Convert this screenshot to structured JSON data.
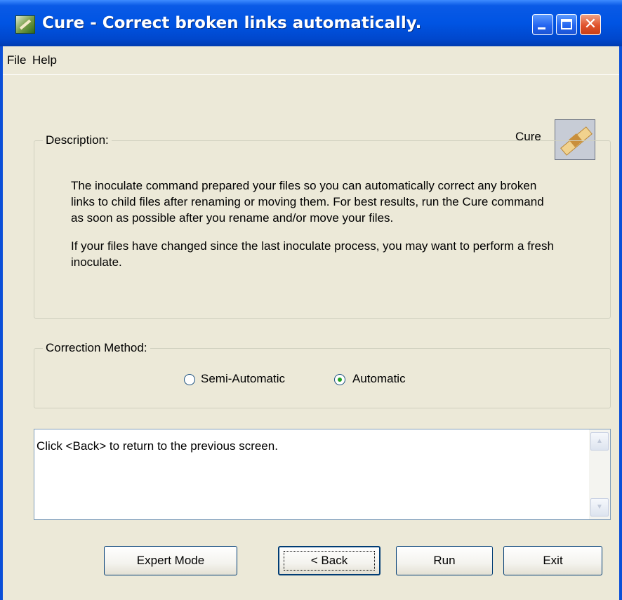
{
  "window": {
    "title": "Cure - Correct broken links automatically."
  },
  "menu": {
    "file": "File",
    "help": "Help"
  },
  "header": {
    "label": "Cure"
  },
  "description": {
    "legend": "Description:",
    "paragraph1": "The inoculate command prepared your files so you can automatically correct any broken links to child files after renaming or moving them. For best results, run the Cure command as soon as possible after you rename and/or move your files.",
    "paragraph2": "If your files have changed since the last inoculate process, you may want to perform a fresh inoculate."
  },
  "correction": {
    "legend": "Correction Method:",
    "options": [
      {
        "label": "Semi-Automatic",
        "selected": false
      },
      {
        "label": "Automatic",
        "selected": true
      }
    ]
  },
  "log": {
    "text": "Click <Back> to return to the previous screen."
  },
  "buttons": {
    "expert": "Expert Mode",
    "back": "< Back",
    "run": "Run",
    "exit": "Exit"
  }
}
